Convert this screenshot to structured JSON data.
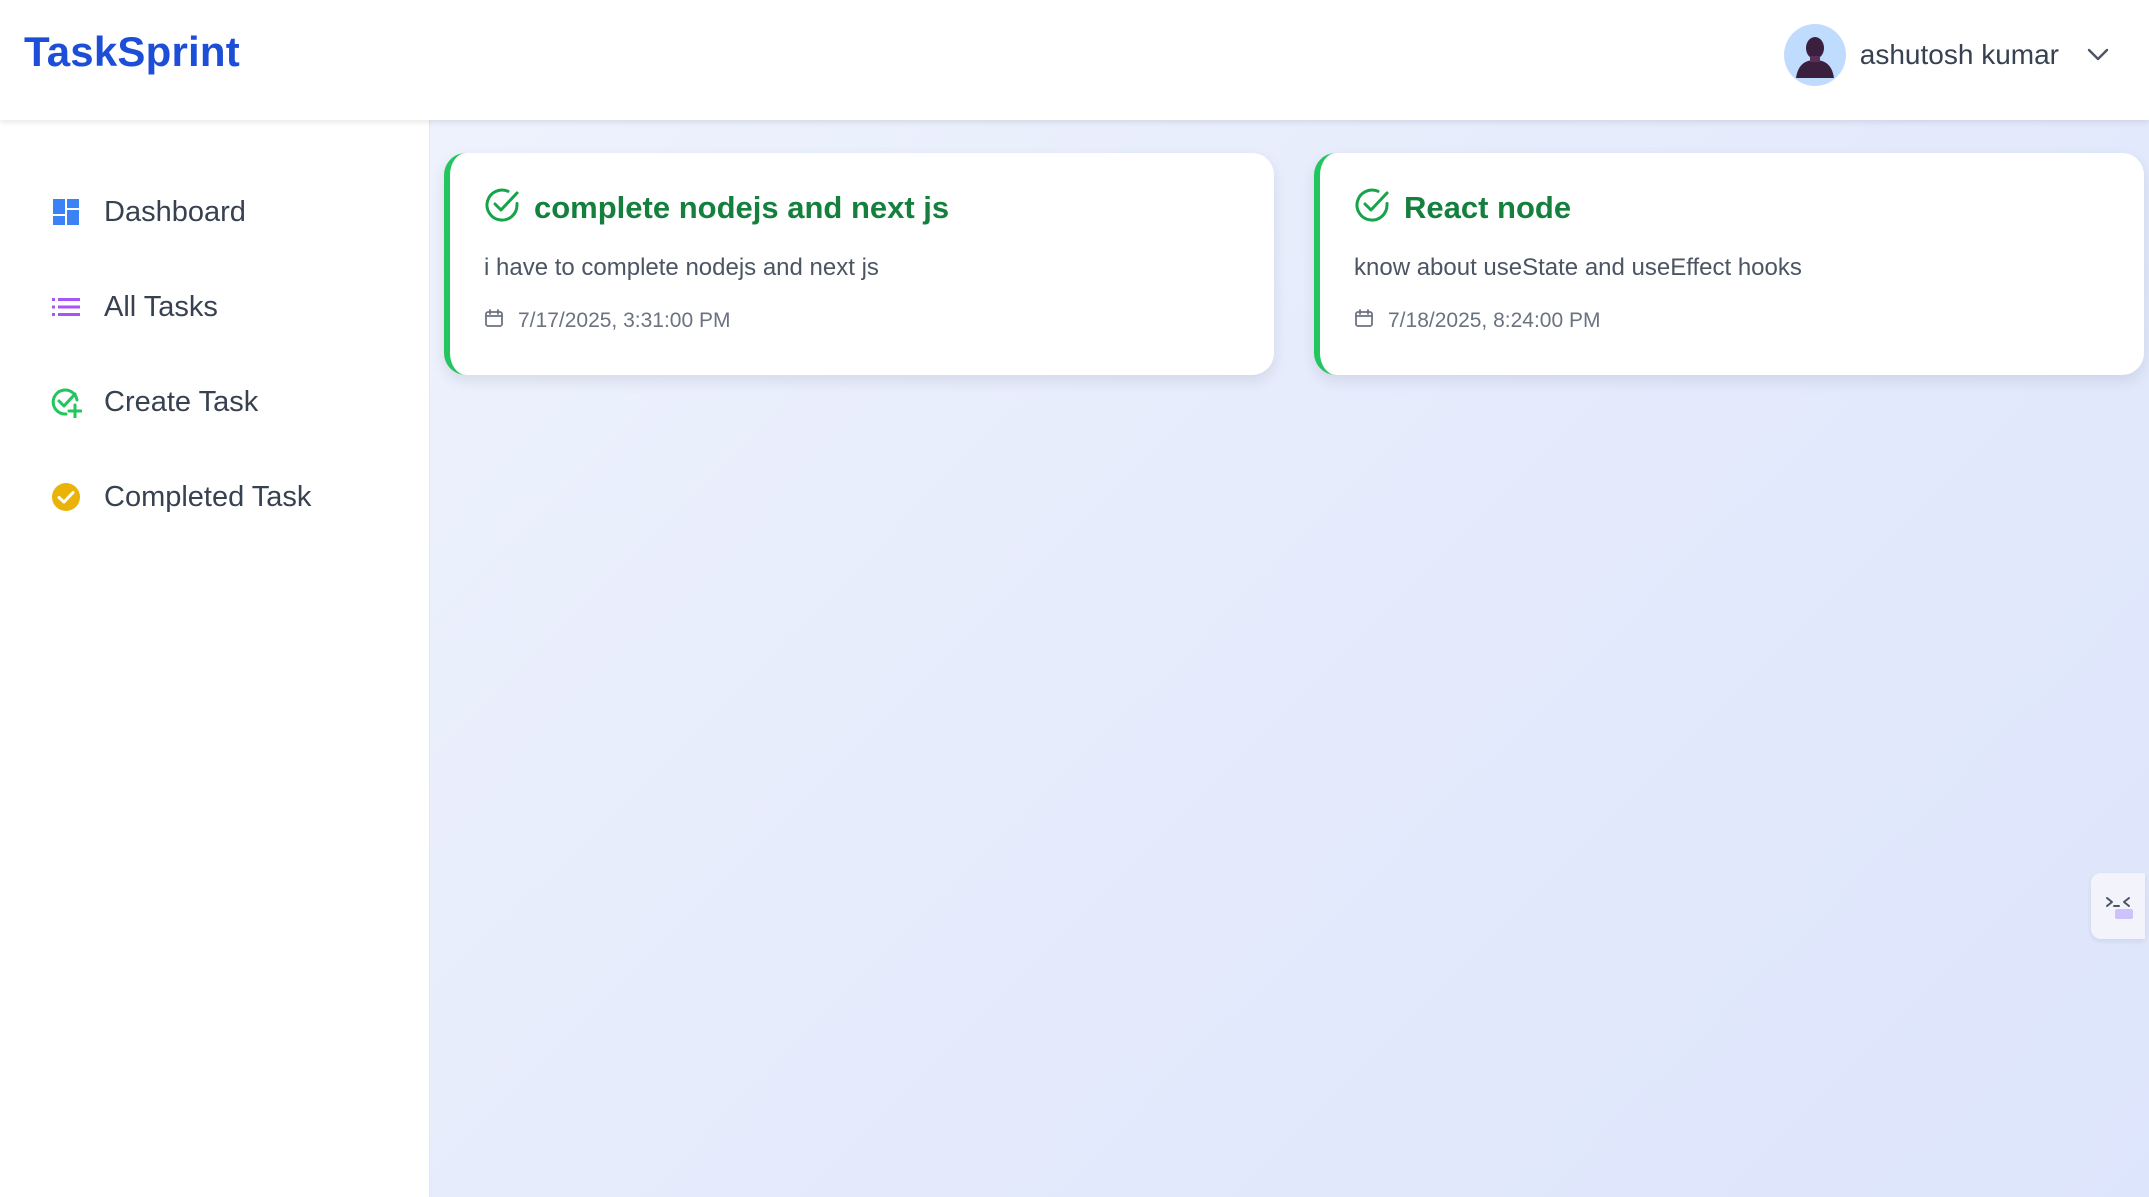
{
  "header": {
    "brand": "TaskSprint",
    "user_name": "ashutosh kumar"
  },
  "sidebar": {
    "items": [
      {
        "label": "Dashboard",
        "icon": "dashboard-icon",
        "color": "#3b82f6"
      },
      {
        "label": "All Tasks",
        "icon": "list-icon",
        "color": "#a855f7"
      },
      {
        "label": "Create Task",
        "icon": "check-plus-icon",
        "color": "#22c55e"
      },
      {
        "label": "Completed Task",
        "icon": "check-circle-filled-icon",
        "color": "#eab308"
      }
    ]
  },
  "tasks": [
    {
      "title": "complete nodejs and next js",
      "description": "i have to complete nodejs and next js",
      "date": "7/17/2025, 3:31:00 PM",
      "status_color": "#22c55e"
    },
    {
      "title": "React node",
      "description": "know about useState and useEffect hooks",
      "date": "7/18/2025, 8:24:00 PM",
      "status_color": "#22c55e"
    }
  ],
  "colors": {
    "brand": "#1d4ed8",
    "task_title": "#15803d"
  }
}
